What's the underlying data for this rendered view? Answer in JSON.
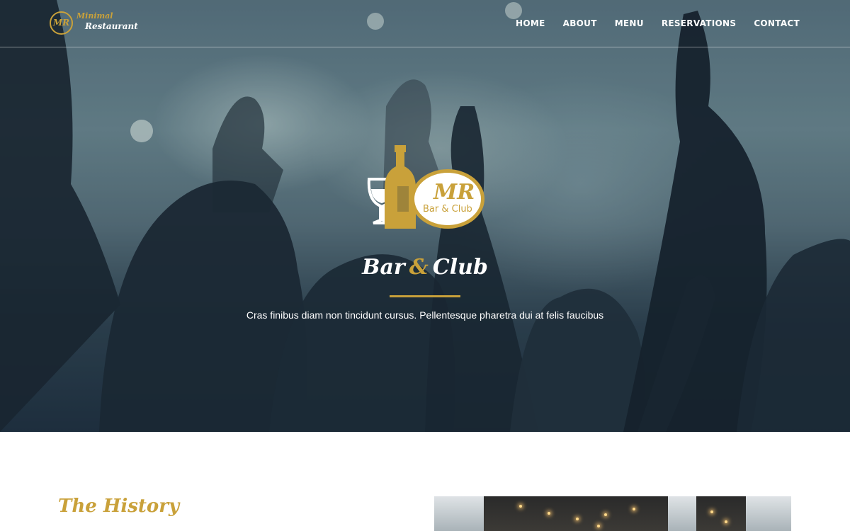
{
  "brand": {
    "monogram": "MR",
    "line1": "Minimal",
    "line2": "Restaurant"
  },
  "nav": {
    "items": [
      "HOME",
      "ABOUT",
      "MENU",
      "RESERVATIONS",
      "CONTACT"
    ]
  },
  "hero": {
    "logo": {
      "monogram": "MR",
      "tagline": "Bar & Club"
    },
    "title_part1": "Bar",
    "title_amp": "&",
    "title_part2": "Club",
    "subtitle": "Cras finibus diam non tincidunt cursus. Pellentesque pharetra dui at felis faucibus"
  },
  "history": {
    "title": "The History"
  },
  "colors": {
    "accent": "#c9a13a",
    "text_light": "#ffffff"
  },
  "icons": {
    "club_logo": "wine-glass-bottle-logo-icon"
  }
}
